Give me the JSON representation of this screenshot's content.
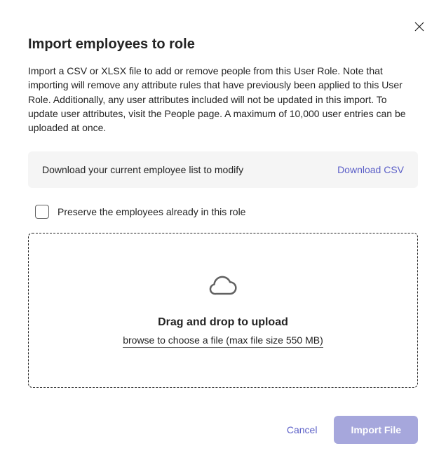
{
  "dialog": {
    "title": "Import employees to role",
    "description": "Import a CSV or XLSX file to add or remove people from this User Role. Note that importing will remove any attribute rules that have previously been applied to this User Role. Additionally, any user attributes included will not be updated in this import. To update user attributes, visit the People page. A maximum of 10,000 user entries can be uploaded at once."
  },
  "downloadBar": {
    "text": "Download your current employee list to modify",
    "linkLabel": "Download CSV"
  },
  "preserve": {
    "label": "Preserve the employees already in this role",
    "checked": false
  },
  "dropzone": {
    "title": "Drag and drop to upload",
    "browseText": "browse to choose a file (max file size 550 MB)"
  },
  "footer": {
    "cancelLabel": "Cancel",
    "importLabel": "Import File"
  }
}
